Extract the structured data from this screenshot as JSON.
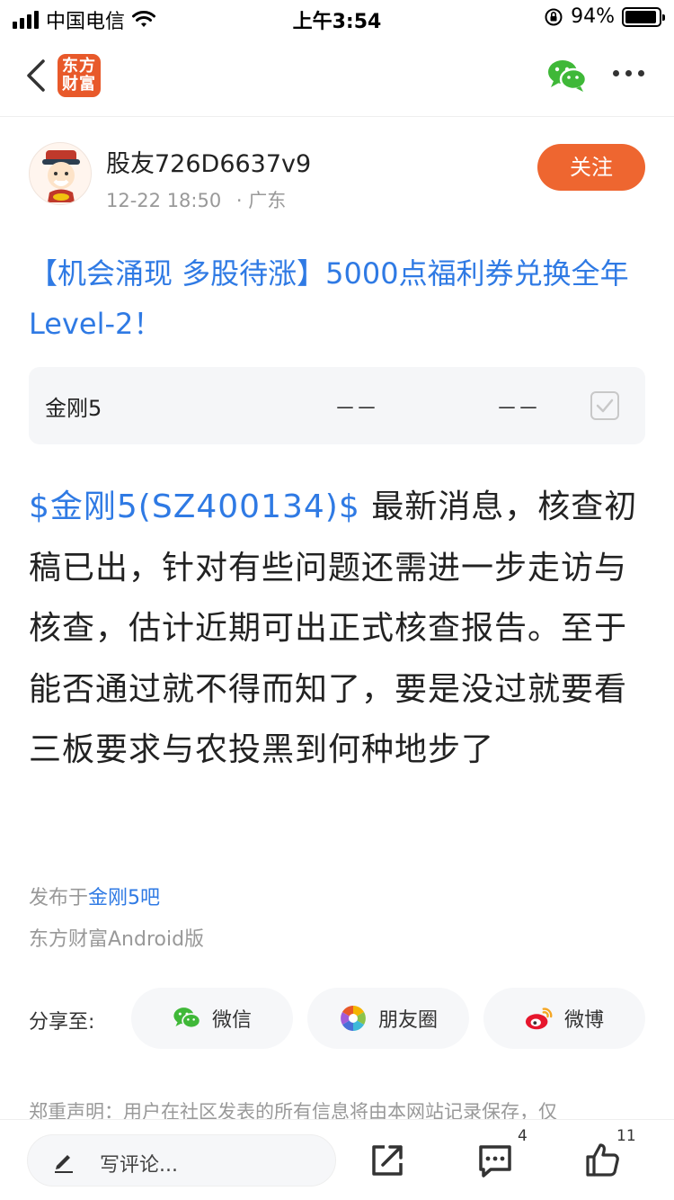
{
  "status": {
    "carrier": "中国电信",
    "time": "上午3:54",
    "battery": "94%",
    "battery_level": 0.94
  },
  "nav": {
    "logo_text_top": "东方",
    "logo_text_bottom": "财富"
  },
  "author": {
    "name": "股友726D6637v9",
    "time": "12-22 18:50",
    "location": "· 广东",
    "follow_label": "关注"
  },
  "post": {
    "title": "【机会涌现 多股待涨】5000点福利券兑换全年Level-2！",
    "stock_card": {
      "name": "金刚5",
      "price": "－－",
      "change": "－－"
    },
    "stock_link": "$金刚5(SZ400134)$",
    "body": " 最新消息，核查初稿已出，针对有些问题还需进一步走访与核查，估计近期可出正式核查报告。至于能否通过就不得而知了，要是没过就要看三板要求与农投黑到何种地步了",
    "published_prefix": "发布于",
    "published_bar": "金刚5吧",
    "client": "东方财富Android版"
  },
  "share": {
    "label": "分享至:",
    "wechat": "微信",
    "moments": "朋友圈",
    "weibo": "微博"
  },
  "disclaimer": "郑重声明：用户在社区发表的所有信息将由本网站记录保存，仅",
  "bottom": {
    "comment_placeholder": "写评论...",
    "comment_count": "4",
    "like_count": "11"
  },
  "colors": {
    "accent_orange": "#ee6630",
    "link_blue": "#2f7ae4",
    "wechat_green": "#3fb838",
    "weibo_red": "#e6162d"
  }
}
